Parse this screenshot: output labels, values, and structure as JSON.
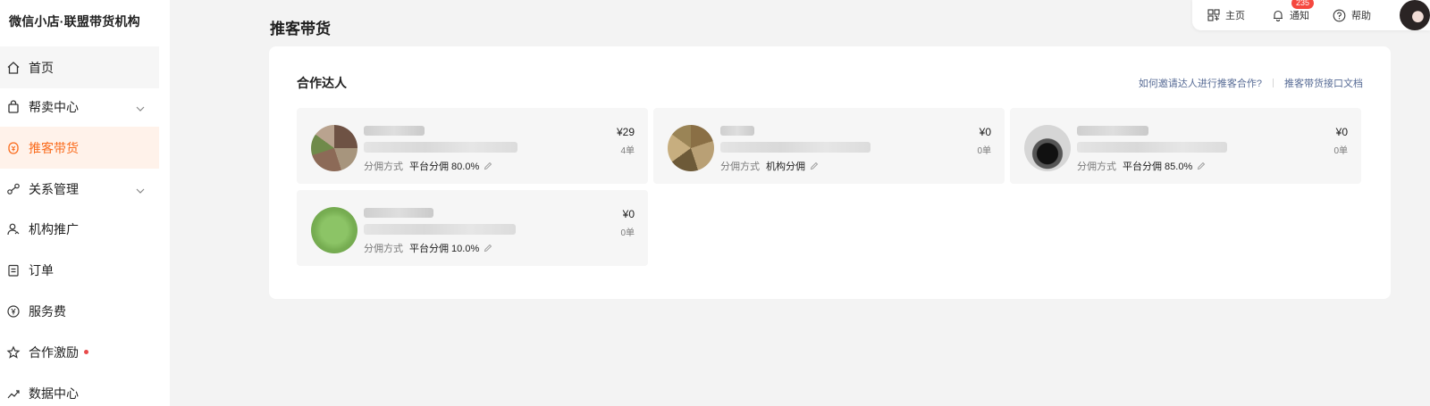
{
  "brand": "微信小店·联盟带货机构",
  "sidebar": {
    "items": [
      {
        "label": "首页"
      },
      {
        "label": "帮卖中心"
      },
      {
        "label": "推客带货"
      },
      {
        "label": "关系管理"
      },
      {
        "label": "机构推广"
      },
      {
        "label": "订单"
      },
      {
        "label": "服务费"
      },
      {
        "label": "合作激励"
      },
      {
        "label": "数据中心"
      }
    ],
    "active": "推客带货"
  },
  "topbar": {
    "home_label": "主页",
    "notify_label": "通知",
    "notify_badge": "235",
    "help_label": "帮助"
  },
  "page_title": "推客带货",
  "section": {
    "title": "合作达人",
    "link_invite": "如何邀请达人进行推客合作?",
    "link_docs": "推客带货接口文档"
  },
  "cards": [
    {
      "amount": "¥29",
      "orders": "4单",
      "commission_label": "分佣方式",
      "commission_value": "平台分佣 80.0%"
    },
    {
      "amount": "¥0",
      "orders": "0单",
      "commission_label": "分佣方式",
      "commission_value": "机构分佣"
    },
    {
      "amount": "¥0",
      "orders": "0单",
      "commission_label": "分佣方式",
      "commission_value": "平台分佣 85.0%"
    },
    {
      "amount": "¥0",
      "orders": "0单",
      "commission_label": "分佣方式",
      "commission_value": "平台分佣 10.0%"
    }
  ],
  "colors": {
    "accent": "#fa6b1c",
    "active_bg": "#fff2ea",
    "link": "#576b95",
    "badge": "#f5483f"
  }
}
